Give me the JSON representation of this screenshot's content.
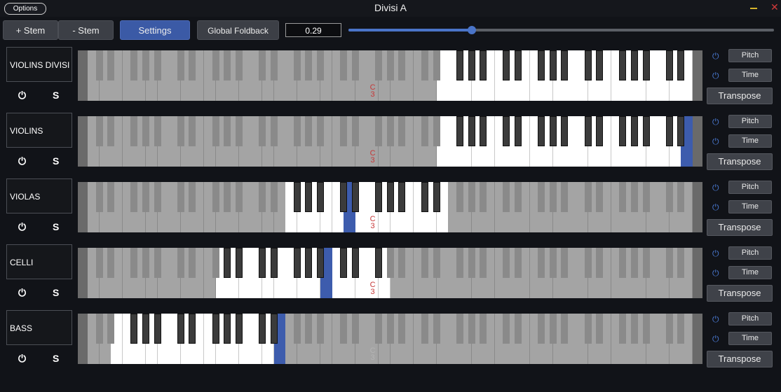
{
  "window": {
    "title": "Divisi A",
    "options_label": "Options"
  },
  "toolbar": {
    "add_stem_label": "+ Stem",
    "remove_stem_label": "- Stem",
    "settings_label": "Settings",
    "global_foldback_label": "Global Foldback",
    "foldback_value": "0.29",
    "foldback_slider_fraction": 0.29
  },
  "colors": {
    "accent": "#3b5aa6",
    "selected_key": "#3d5cad",
    "close": "#d23a3a",
    "minimize": "#d7b52a",
    "gold_key": "#c6b38a"
  },
  "icons": {
    "power": "power-icon",
    "solo": "solo-icon",
    "close": "close-icon",
    "minimize": "minimize-icon"
  },
  "rows": [
    {
      "name": "VIOLINS DIVISI",
      "range": [
        30,
        73
      ],
      "selected": 54,
      "gold": [],
      "c3_dim": false,
      "pitch_label": "Pitch",
      "time_label": "Time",
      "transpose_label": "Transpose",
      "solo_label": "S"
    },
    {
      "name": "VIOLINS",
      "range": [
        30,
        73
      ],
      "selected": 51,
      "gold": [
        73
      ],
      "c3_dim": false,
      "pitch_label": "Pitch",
      "time_label": "Time",
      "transpose_label": "Transpose",
      "solo_label": "S"
    },
    {
      "name": "VIOLAS",
      "range": [
        17,
        30
      ],
      "selected": 22,
      "gold": [],
      "c3_dim": false,
      "pitch_label": "Pitch",
      "time_label": "Time",
      "transpose_label": "Transpose",
      "solo_label": "S"
    },
    {
      "name": "CELLI",
      "range": [
        11,
        25
      ],
      "selected": 20,
      "gold": [],
      "c3_dim": false,
      "pitch_label": "Pitch",
      "time_label": "Time",
      "transpose_label": "Transpose",
      "solo_label": "S"
    },
    {
      "name": "BASS",
      "range": [
        2,
        16
      ],
      "selected": 16,
      "gold": [],
      "c3_dim": true,
      "pitch_label": "Pitch",
      "time_label": "Time",
      "transpose_label": "Transpose",
      "solo_label": "S"
    }
  ],
  "c3_label": "C\n3",
  "c3_white_index": 24
}
